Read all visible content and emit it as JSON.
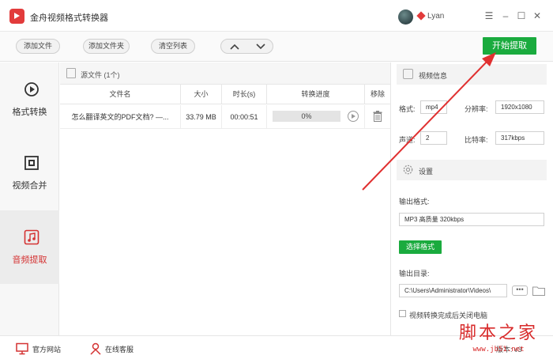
{
  "app": {
    "title": "金舟视频格式转换器",
    "username": "Lyan"
  },
  "window": {
    "menu": "☰",
    "minimize": "–",
    "maximize": "☐",
    "close": "✕"
  },
  "toolbar": {
    "add_file": "添加文件",
    "add_folder": "添加文件夹",
    "clear_list": "清空列表",
    "start_button": "开始提取"
  },
  "sidebar": {
    "items": [
      {
        "label": "格式转换",
        "icon": "convert-icon"
      },
      {
        "label": "视频合并",
        "icon": "merge-icon"
      },
      {
        "label": "音频提取",
        "icon": "music-icon",
        "active": true
      }
    ]
  },
  "file_list": {
    "header": "源文件 (1个)",
    "columns": [
      "文件名",
      "大小",
      "时长(s)",
      "转换进度",
      "移除"
    ],
    "rows": [
      {
        "name": "怎么翻译英文的PDF文档? —...",
        "size": "33.79 MB",
        "duration": "00:00:51",
        "progress_text": "0%",
        "progress": 0
      }
    ]
  },
  "video_info": {
    "title": "视频信息",
    "format_label": "格式:",
    "format_value": "mp4",
    "resolution_label": "分辨率:",
    "resolution_value": "1920x1080",
    "channel_label": "声道:",
    "channel_value": "2",
    "bitrate_label": "比特率:",
    "bitrate_value": "317kbps"
  },
  "settings": {
    "title": "设置",
    "output_format_label": "输出格式:",
    "output_format_value": "MP3 高质量 320kbps",
    "choose_format_button": "选择格式",
    "output_dir_label": "输出目录:",
    "output_dir_value": "C:\\Users\\Administrator\\Videos\\",
    "browse_button": "•••",
    "shutdown_label": "视频转换完成后关闭电脑",
    "shutdown_checked": false
  },
  "bottom": {
    "website": "官方网站",
    "service": "在线客服",
    "version": "版本: v3"
  },
  "watermark": {
    "main": "脚本之家",
    "sub": "www.jb51.net"
  },
  "colors": {
    "accent_green": "#1aab3e",
    "brand_red": "#e23b3b",
    "arrow_red": "#e03030"
  }
}
